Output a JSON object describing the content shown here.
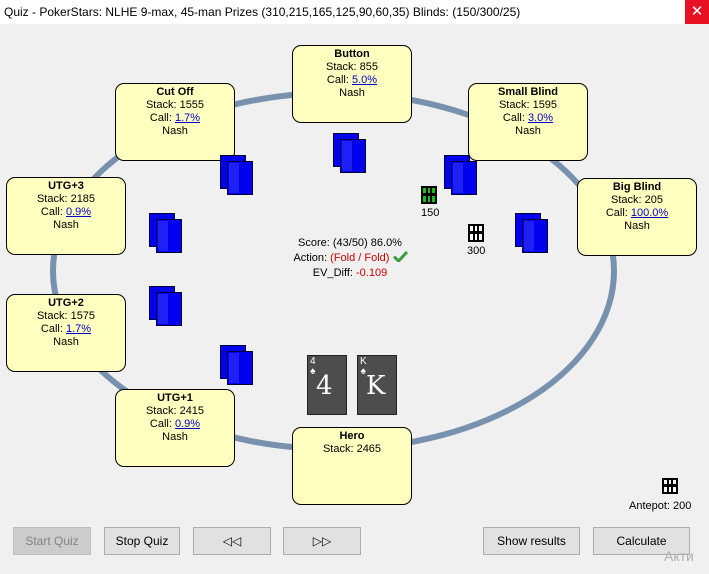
{
  "window": {
    "title": "Quiz - PokerStars: NLHE 9-max, 45-man Prizes (310,215,165,125,90,60,35) Blinds: (150/300/25)",
    "close_glyph": "✕"
  },
  "seats": {
    "button": {
      "name": "Button",
      "stack": "Stack: 855",
      "call_prefix": "Call: ",
      "call": "5.0%",
      "mode": "Nash"
    },
    "small_blind": {
      "name": "Small Blind",
      "stack": "Stack: 1595",
      "call_prefix": "Call: ",
      "call": "3.0%",
      "mode": "Nash"
    },
    "big_blind": {
      "name": "Big Blind",
      "stack": "Stack: 205",
      "call_prefix": "Call: ",
      "call": "100.0%",
      "mode": "Nash"
    },
    "cut_off": {
      "name": "Cut Off",
      "stack": "Stack: 1555",
      "call_prefix": "Call: ",
      "call": "1.7%",
      "mode": "Nash"
    },
    "utg3": {
      "name": "UTG+3",
      "stack": "Stack: 2185",
      "call_prefix": "Call: ",
      "call": "0.9%",
      "mode": "Nash"
    },
    "utg2": {
      "name": "UTG+2",
      "stack": "Stack: 1575",
      "call_prefix": "Call: ",
      "call": "1.7%",
      "mode": "Nash"
    },
    "utg1": {
      "name": "UTG+1",
      "stack": "Stack: 2415",
      "call_prefix": "Call: ",
      "call": "0.9%",
      "mode": "Nash"
    },
    "hero": {
      "name": "Hero",
      "stack": "Stack: 2465"
    }
  },
  "bets": {
    "small_blind": "150",
    "big_blind": "300"
  },
  "antepot": "Antepot: 200",
  "result": {
    "score": "Score: (43/50) 86.0%",
    "action_label": "Action: ",
    "action_open": "(",
    "action_value": "Fold",
    "action_sep": " / ",
    "action_correct": "Fold",
    "action_close": ")",
    "ev_label": "EV_Diff: ",
    "ev_value": "-0.109"
  },
  "hero_cards": [
    {
      "rank": "4",
      "suit": "♠"
    },
    {
      "rank": "K",
      "suit": "♠"
    }
  ],
  "buttons": {
    "start_quiz": "Start Quiz",
    "stop_quiz": "Stop Quiz",
    "prev": "◁◁",
    "next": "▷▷",
    "show_results": "Show results",
    "calculate": "Calculate"
  },
  "watermark": "Акти",
  "colors": {
    "table_rail": "#7891ae",
    "seat_fill": "#ffffc0",
    "card_back": "#0000ee",
    "close": "#e81123"
  }
}
